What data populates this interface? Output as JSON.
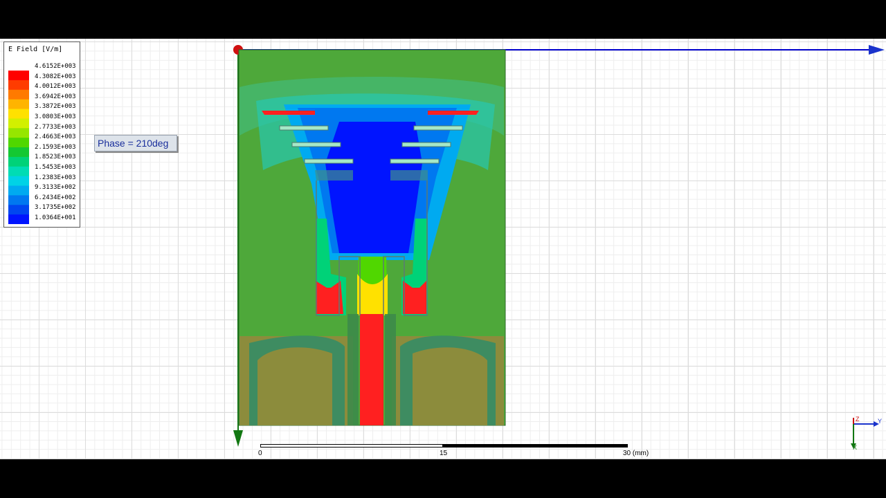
{
  "legend": {
    "title": "E Field [V/m]",
    "labels": [
      "4.6152E+003",
      "4.3082E+003",
      "4.0012E+003",
      "3.6942E+003",
      "3.3872E+003",
      "3.0803E+003",
      "2.7733E+003",
      "2.4663E+003",
      "2.1593E+003",
      "1.8523E+003",
      "1.5453E+003",
      "1.2383E+003",
      "9.3133E+002",
      "6.2434E+002",
      "3.1735E+002",
      "1.0364E+001"
    ],
    "colors": [
      "#ff0000",
      "#ff3c00",
      "#ff7a00",
      "#ffb400",
      "#ffe100",
      "#d2f000",
      "#96e600",
      "#50d700",
      "#14c832",
      "#00d278",
      "#00dcb4",
      "#00d2e6",
      "#00aaf0",
      "#0078f0",
      "#0046f0",
      "#0014ff"
    ]
  },
  "phase": {
    "label": "Phase = 210deg"
  },
  "scale": {
    "labels": [
      "0",
      "15",
      "30 (mm)"
    ]
  },
  "axes": {
    "x_label": "X",
    "y_label": "Y",
    "z_label": "Z"
  },
  "colors": {
    "background_board": "#4ea83a",
    "ground": "#8c8c3c",
    "feed": "#ff2020",
    "patch": "#1a1aff"
  }
}
